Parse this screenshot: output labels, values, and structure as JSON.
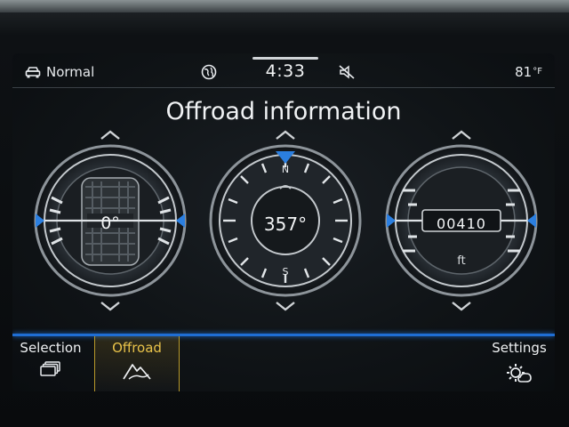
{
  "status": {
    "drive_profile": "Normal",
    "time": "4:33",
    "temperature": "81",
    "temperature_unit": "°F",
    "icons": [
      "car-icon",
      "globe-icon",
      "mute-icon"
    ]
  },
  "page": {
    "title": "Offroad information"
  },
  "gauges": {
    "tilt": {
      "value": "0°"
    },
    "compass": {
      "value": "357°",
      "north": "N",
      "south": "S"
    },
    "altitude": {
      "value": "00410",
      "unit": "ft"
    }
  },
  "nav": {
    "selection": {
      "label": "Selection",
      "icon": "cards-icon"
    },
    "offroad": {
      "label": "Offroad",
      "icon": "mountain-icon",
      "active": true
    },
    "settings": {
      "label": "Settings",
      "icon": "gear-sun-icon"
    }
  },
  "colors": {
    "accent": "#1f6ed4",
    "active_tab": "#e9c34a"
  }
}
